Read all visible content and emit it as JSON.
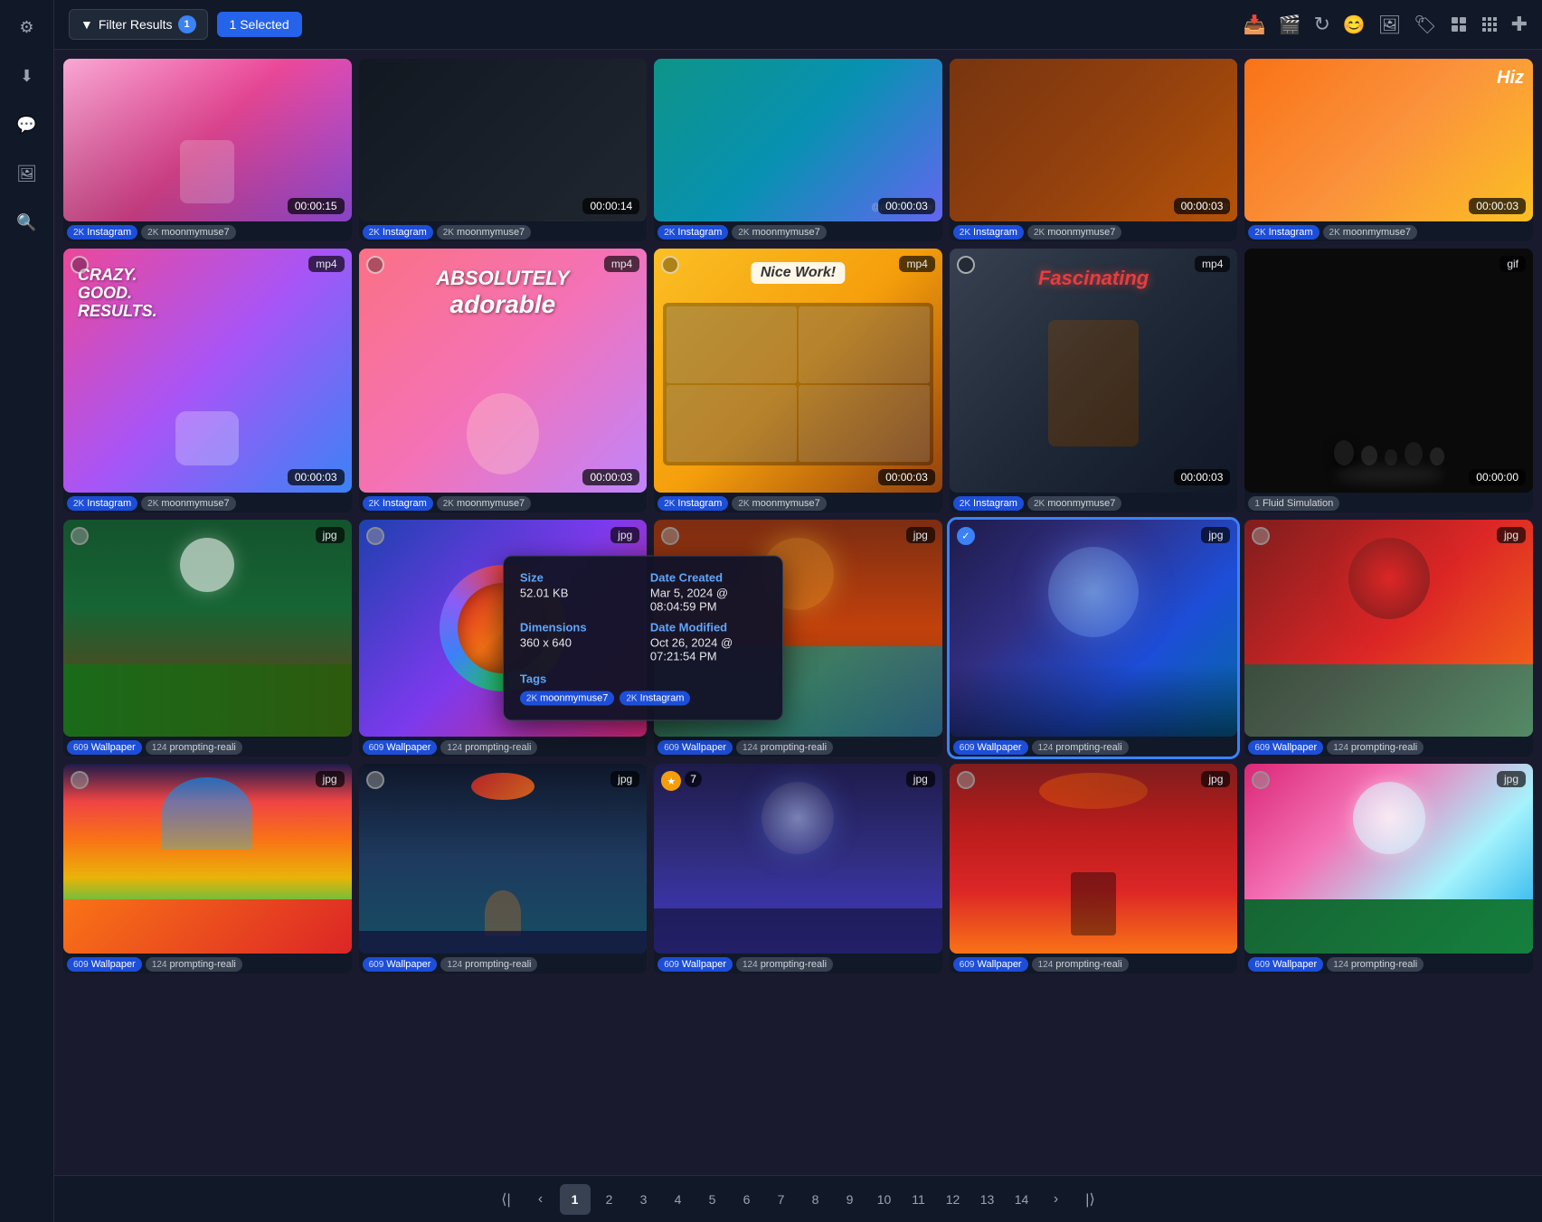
{
  "sidebar": {
    "icons": [
      {
        "name": "settings-icon",
        "glyph": "⚙"
      },
      {
        "name": "download-icon",
        "glyph": "⬇"
      },
      {
        "name": "chat-icon",
        "glyph": "💬"
      },
      {
        "name": "image-icon",
        "glyph": "🖼"
      },
      {
        "name": "search-icon",
        "glyph": "🔍"
      }
    ]
  },
  "toolbar": {
    "filter_label": "Filter Results",
    "filter_count": "1",
    "selected_label": "1 Selected",
    "icons": [
      {
        "name": "inbox-icon",
        "glyph": "📥"
      },
      {
        "name": "video-icon",
        "glyph": "🎬"
      },
      {
        "name": "refresh-icon",
        "glyph": "↻"
      },
      {
        "name": "face-icon",
        "glyph": "😊"
      },
      {
        "name": "gallery-icon",
        "glyph": "🖼"
      },
      {
        "name": "tag-icon",
        "glyph": "🏷"
      },
      {
        "name": "grid-icon",
        "glyph": "⊞"
      },
      {
        "name": "grid2-icon",
        "glyph": "⊟"
      },
      {
        "name": "plus-icon",
        "glyph": "✚"
      }
    ]
  },
  "rows": [
    {
      "cards": [
        {
          "id": "r1c1",
          "bg": "bg-pink",
          "format": null,
          "duration": "00:00:15",
          "tags": [
            {
              "num": "2K",
              "label": "Instagram",
              "style": "blue"
            },
            {
              "num": "2K",
              "label": "moonmymuse7",
              "style": "gray"
            }
          ],
          "selected": false
        },
        {
          "id": "r1c2",
          "bg": "bg-dark",
          "format": null,
          "duration": "00:00:14",
          "tags": [
            {
              "num": "2K",
              "label": "Instagram",
              "style": "blue"
            },
            {
              "num": "2K",
              "label": "moonmymuse7",
              "style": "gray"
            }
          ],
          "selected": false
        },
        {
          "id": "r1c3",
          "bg": "bg-teal",
          "format": null,
          "duration": "00:00:03",
          "tags": [
            {
              "num": "2K",
              "label": "Instagram",
              "style": "blue"
            },
            {
              "num": "2K",
              "label": "moonmymuse7",
              "style": "gray"
            }
          ],
          "selected": false
        },
        {
          "id": "r1c4",
          "bg": "bg-brown",
          "format": null,
          "duration": "00:00:03",
          "tags": [
            {
              "num": "2K",
              "label": "Instagram",
              "style": "blue"
            },
            {
              "num": "2K",
              "label": "moonmymuse7",
              "style": "gray"
            }
          ],
          "selected": false
        },
        {
          "id": "r1c5",
          "bg": "bg-orange",
          "format": null,
          "duration": "00:00:03",
          "tags": [
            {
              "num": "2K",
              "label": "Instagram",
              "style": "blue"
            },
            {
              "num": "2K",
              "label": "moonmymuse7",
              "style": "gray"
            }
          ],
          "selected": false
        }
      ]
    },
    {
      "cards": [
        {
          "id": "r2c1",
          "bg": "bg-crazy",
          "format": "mp4",
          "duration": "00:00:03",
          "tags": [
            {
              "num": "2K",
              "label": "Instagram",
              "style": "blue"
            },
            {
              "num": "2K",
              "label": "moonmymuse7",
              "style": "gray"
            }
          ],
          "selected": false
        },
        {
          "id": "r2c2",
          "bg": "bg-adorable",
          "format": "mp4",
          "duration": "00:00:03",
          "tags": [
            {
              "num": "2K",
              "label": "Instagram",
              "style": "blue"
            },
            {
              "num": "2K",
              "label": "moonmymuse7",
              "style": "gray"
            }
          ],
          "selected": false
        },
        {
          "id": "r2c3",
          "bg": "bg-nicework",
          "format": "mp4",
          "duration": "00:00:03",
          "tags": [
            {
              "num": "2K",
              "label": "Instagram",
              "style": "blue"
            },
            {
              "num": "2K",
              "label": "moonmymuse7",
              "style": "gray"
            }
          ],
          "selected": false
        },
        {
          "id": "r2c4",
          "bg": "bg-fascinating",
          "format": "mp4",
          "duration": "00:00:03",
          "tags": [
            {
              "num": "2K",
              "label": "Instagram",
              "style": "blue"
            },
            {
              "num": "2K",
              "label": "moonmymuse7",
              "style": "gray"
            }
          ],
          "selected": false
        },
        {
          "id": "r2c5",
          "bg": "bg-black-obj",
          "format": "gif",
          "duration": "00:00:00",
          "tags": [
            {
              "num": "1",
              "label": "Fluid Simulation",
              "style": "gray"
            }
          ],
          "selected": false
        }
      ]
    },
    {
      "cards": [
        {
          "id": "r3c1",
          "bg": "bg-forest",
          "format": "jpg",
          "duration": null,
          "tags": [
            {
              "num": "609",
              "label": "Wallpaper",
              "style": "blue"
            },
            {
              "num": "124",
              "label": "prompting-reali",
              "style": "gray"
            }
          ],
          "selected": false
        },
        {
          "id": "r3c2",
          "bg": "bg-mountain",
          "format": "jpg",
          "duration": null,
          "tooltip": true,
          "tags": [
            {
              "num": "609",
              "label": "Wallpaper",
              "style": "blue"
            },
            {
              "num": "124",
              "label": "prompting-reali",
              "style": "gray"
            }
          ],
          "selected": false
        },
        {
          "id": "r3c3",
          "bg": "bg-sunset-lake",
          "format": "jpg",
          "duration": null,
          "tags": [
            {
              "num": "609",
              "label": "Wallpaper",
              "style": "blue"
            },
            {
              "num": "124",
              "label": "prompting-reali",
              "style": "gray"
            }
          ],
          "selected": false
        },
        {
          "id": "r3c4",
          "bg": "bg-galaxy",
          "format": "jpg",
          "duration": null,
          "tags": [
            {
              "num": "609",
              "label": "Wallpaper",
              "style": "blue"
            },
            {
              "num": "124",
              "label": "prompting-reali",
              "style": "gray"
            }
          ],
          "selected": true
        },
        {
          "id": "r3c5",
          "bg": "bg-red-mountain",
          "format": "jpg",
          "duration": null,
          "tags": [
            {
              "num": "609",
              "label": "Wallpaper",
              "style": "blue"
            },
            {
              "num": "124",
              "label": "prompting-reali",
              "style": "gray"
            }
          ],
          "selected": false
        }
      ]
    },
    {
      "cards": [
        {
          "id": "r4c1",
          "bg": "bg-rainbow",
          "format": "jpg",
          "duration": null,
          "tags": [
            {
              "num": "609",
              "label": "Wallpaper",
              "style": "blue"
            },
            {
              "num": "124",
              "label": "prompting-reali",
              "style": "gray"
            }
          ],
          "selected": false
        },
        {
          "id": "r4c2",
          "bg": "bg-mushroom",
          "format": "jpg",
          "duration": null,
          "tags": [
            {
              "num": "609",
              "label": "Wallpaper",
              "style": "blue"
            },
            {
              "num": "124",
              "label": "prompting-reali",
              "style": "gray"
            }
          ],
          "selected": false
        },
        {
          "id": "r4c3",
          "bg": "bg-cosmos",
          "format": "jpg",
          "duration": null,
          "star": true,
          "star_count": "7",
          "tags": [
            {
              "num": "609",
              "label": "Wallpaper",
              "style": "blue"
            },
            {
              "num": "124",
              "label": "prompting-reali",
              "style": "gray"
            }
          ],
          "selected": false
        },
        {
          "id": "r4c4",
          "bg": "bg-fire-tree",
          "format": "jpg",
          "duration": null,
          "tags": [
            {
              "num": "609",
              "label": "Wallpaper",
              "style": "blue"
            },
            {
              "num": "124",
              "label": "prompting-reali",
              "style": "gray"
            }
          ],
          "selected": false
        },
        {
          "id": "r4c5",
          "bg": "bg-pink-island",
          "format": "jpg",
          "duration": null,
          "tags": [
            {
              "num": "609",
              "label": "Wallpaper",
              "style": "blue"
            },
            {
              "num": "124",
              "label": "prompting-reali",
              "style": "gray"
            }
          ],
          "selected": false
        }
      ]
    }
  ],
  "tooltip": {
    "size_label": "Size",
    "size_value": "52.01 KB",
    "date_created_label": "Date Created",
    "date_created_value": "Mar 5, 2024 @ 08:04:59 PM",
    "dimensions_label": "Dimensions",
    "dimensions_value": "360 x 640",
    "date_modified_label": "Date Modified",
    "date_modified_value": "Oct 26, 2024 @ 07:21:54 PM",
    "tags_label": "Tags",
    "tags": [
      {
        "num": "2K",
        "label": "moonmymuse7",
        "style": "blue"
      },
      {
        "num": "2K",
        "label": "Instagram",
        "style": "blue"
      }
    ]
  },
  "pagination": {
    "pages": [
      "1",
      "2",
      "3",
      "4",
      "5",
      "6",
      "7",
      "8",
      "9",
      "10",
      "11",
      "12",
      "13",
      "14"
    ],
    "current": "1"
  }
}
